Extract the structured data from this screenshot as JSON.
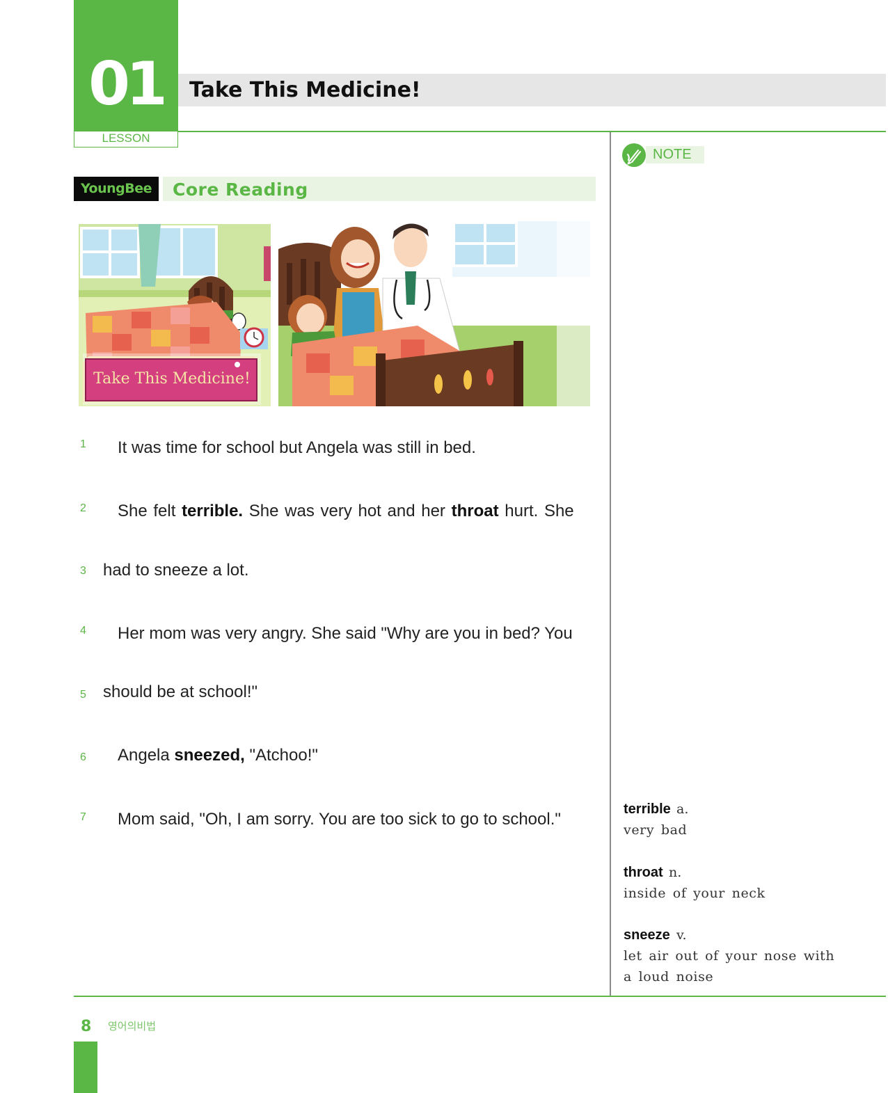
{
  "lesson": {
    "number": "01",
    "label": "LESSON"
  },
  "title": "Take This Medicine!",
  "note": {
    "label": "NOTE",
    "icon": "pencil-icon"
  },
  "section": {
    "tag": "YoungBee",
    "title": "Core Reading"
  },
  "illustration": {
    "caption": "Take This Medicine!"
  },
  "reading": {
    "line1": {
      "no": "1",
      "text": "It was time for school but Angela was still in bed."
    },
    "line2": {
      "no": "2",
      "a": "She felt ",
      "b": "terrible.",
      "c": " She was very hot and her ",
      "d": "throat",
      "e": " hurt. She"
    },
    "line3": {
      "no": "3",
      "text": "had to sneeze a lot."
    },
    "line4": {
      "no": "4",
      "text": "Her mom was very angry. She said \"Why are you in bed? You"
    },
    "line5": {
      "no": "5",
      "text": "should be at school!\""
    },
    "line6": {
      "no": "6",
      "a": "Angela ",
      "b": "sneezed,",
      "c": " \"Atchoo!\""
    },
    "line7": {
      "no": "7",
      "text": "Mom said, \"Oh, I am sorry. You are too sick to go to school.\""
    }
  },
  "vocabulary": [
    {
      "word": "terrible",
      "pos": "a.",
      "def1": "very bad",
      "def2": ""
    },
    {
      "word": "throat",
      "pos": "n.",
      "def1": "inside of your neck",
      "def2": ""
    },
    {
      "word": "sneeze",
      "pos": "v.",
      "def1": "let air out of your nose with",
      "def2": "a loud noise"
    }
  ],
  "footer": {
    "page": "8",
    "book": "영어의비법"
  },
  "colors": {
    "accent": "#5bb745",
    "accent_light": "#e9f4e3",
    "title_bar": "#e6e6e6"
  }
}
